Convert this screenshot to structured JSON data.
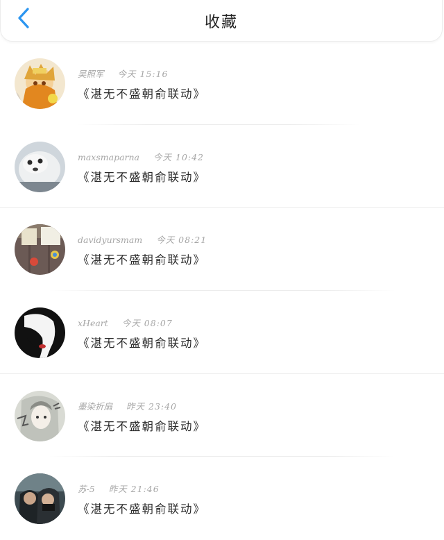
{
  "header": {
    "title": "收藏",
    "back_icon": "chevron-left-icon",
    "accent_color": "#2b95f0"
  },
  "items": [
    {
      "user": "吴照军",
      "time": "今天 15:16",
      "title": "《湛无不盛朝俞联动》",
      "avatar_icon": "anime-character-avatar"
    },
    {
      "user": "maxsmaparna",
      "time": "今天 10:42",
      "title": "《湛无不盛朝俞联动》",
      "avatar_icon": "seal-pup-avatar"
    },
    {
      "user": "davidyursmam",
      "time": "今天 08:21",
      "title": "《湛无不盛朝俞联动》",
      "avatar_icon": "room-decor-avatar"
    },
    {
      "user": "xHeart",
      "time": "今天 08:07",
      "title": "《湛无不盛朝俞联动》",
      "avatar_icon": "silhouette-avatar"
    },
    {
      "user": "墨染折扇",
      "time": "昨天 23:40",
      "title": "《湛无不盛朝俞联动》",
      "avatar_icon": "sketch-girl-avatar"
    },
    {
      "user": "苏-5",
      "time": "昨天 21:46",
      "title": "《湛无不盛朝俞联动》",
      "avatar_icon": "photo-couple-avatar"
    }
  ]
}
